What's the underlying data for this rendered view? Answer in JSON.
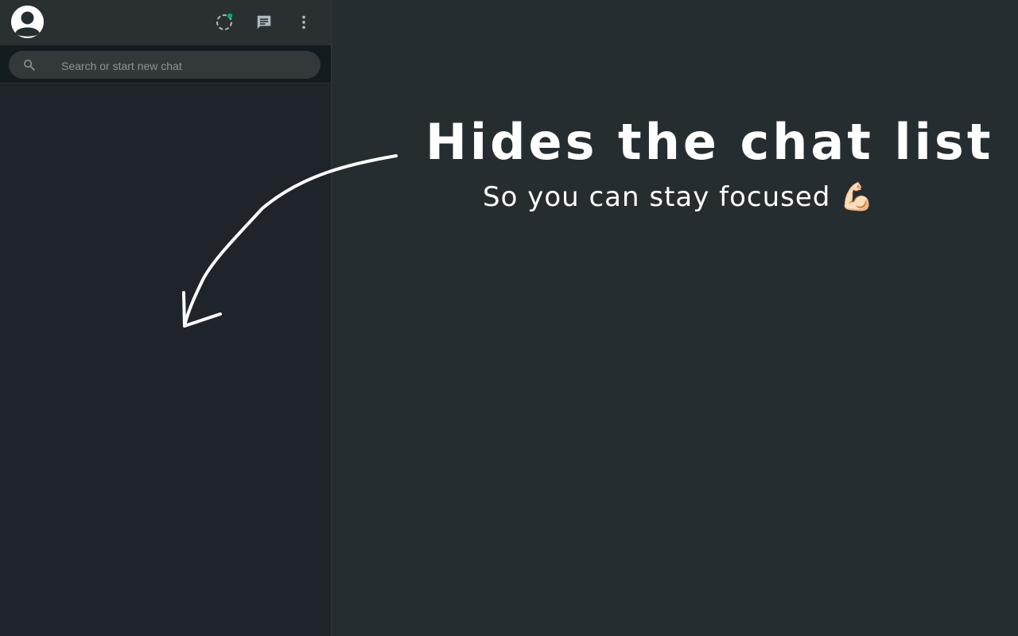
{
  "sidebar": {
    "header": {
      "avatar_icon": "person-avatar-icon",
      "status_icon": "status-icon",
      "new_chat_icon": "new-chat-icon",
      "menu_icon": "menu-icon"
    },
    "search": {
      "placeholder": "Search or start new chat",
      "value": ""
    }
  },
  "main": {
    "promo_title": "Hides the chat list",
    "promo_subtitle": "So you can stay focused 💪🏻"
  },
  "colors": {
    "sidebar_bg": "#1f232a",
    "header_bg": "#2a2f32",
    "main_bg": "#262d31",
    "accent": "#00a884"
  }
}
